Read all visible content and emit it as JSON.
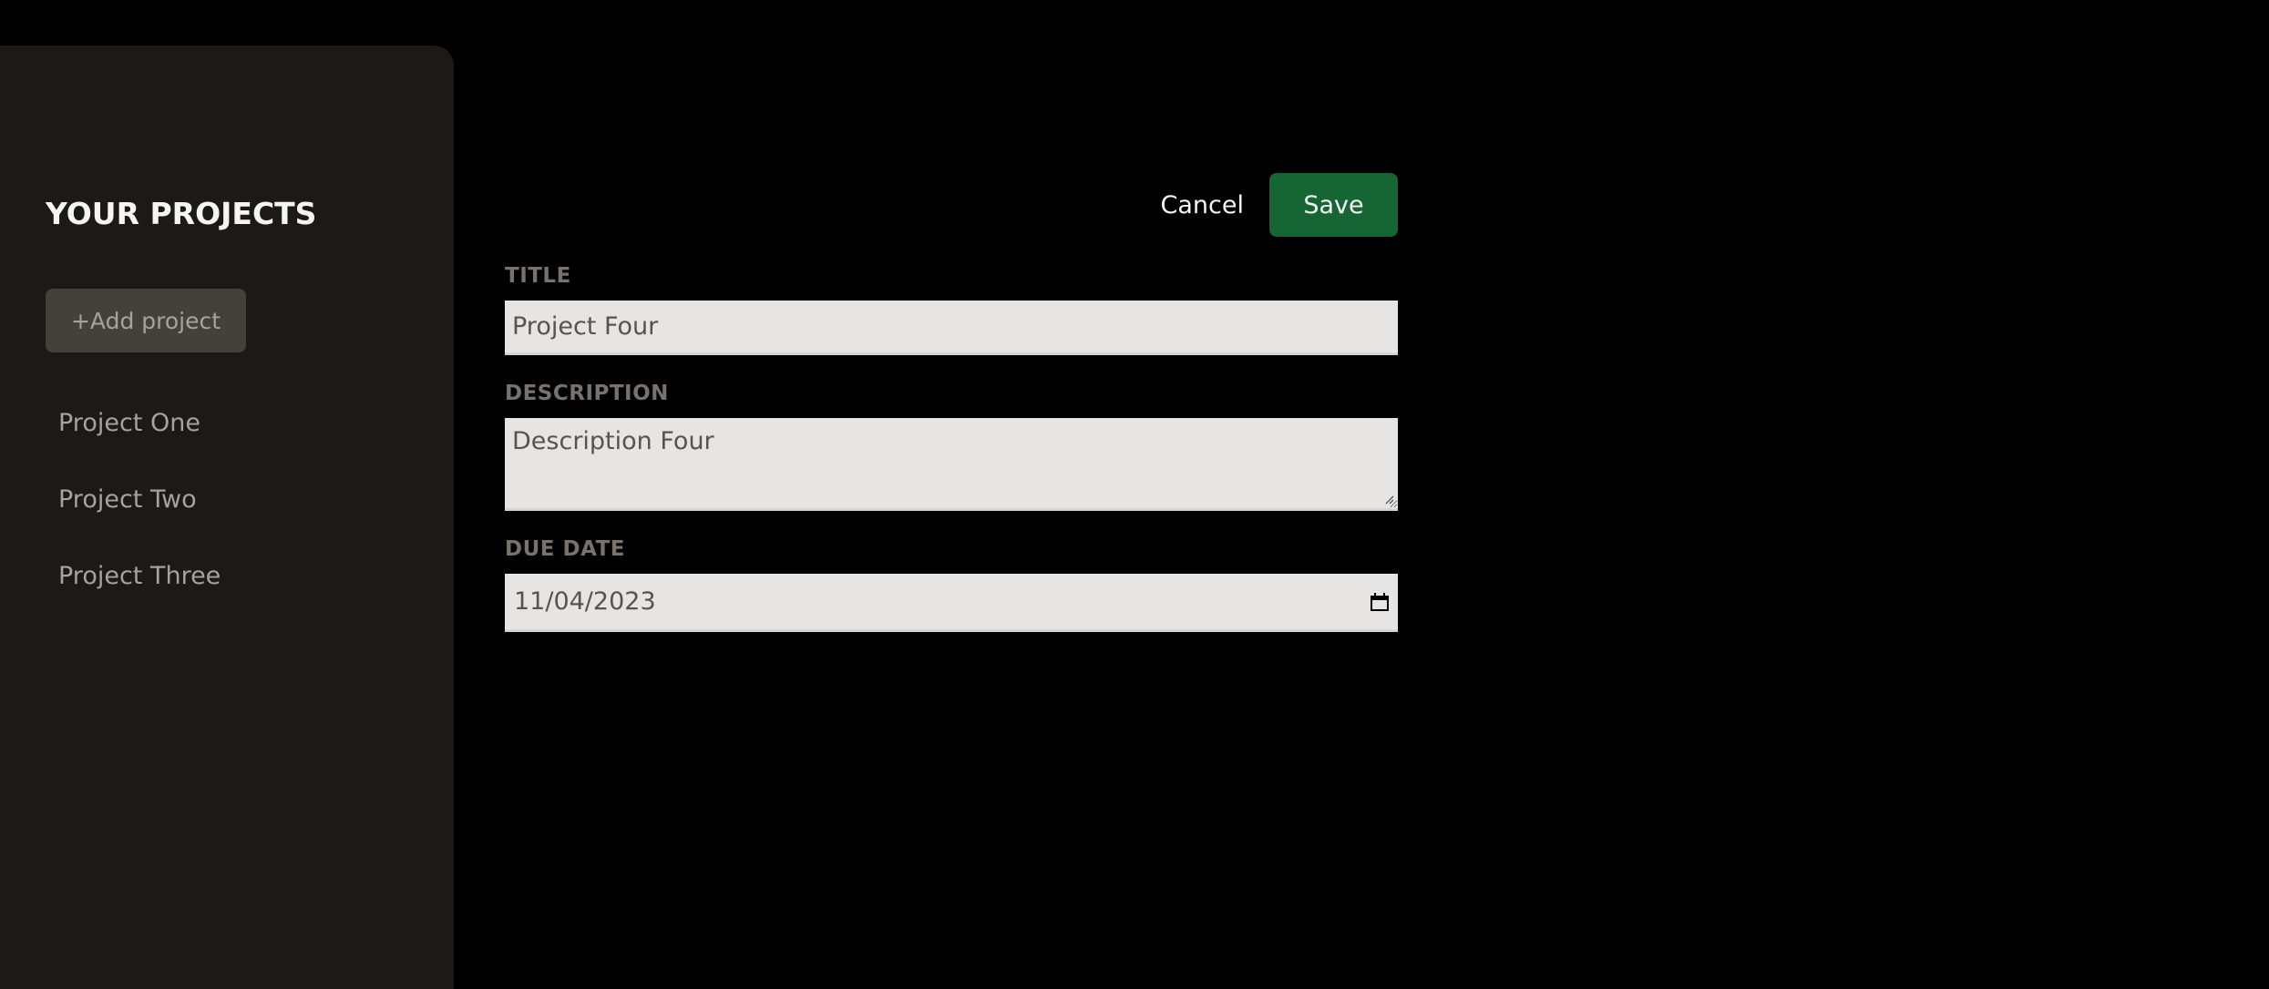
{
  "sidebar": {
    "title": "YOUR PROJECTS",
    "add_button": "+Add project",
    "projects": [
      {
        "label": "Project One"
      },
      {
        "label": "Project Two"
      },
      {
        "label": "Project Three"
      }
    ]
  },
  "form": {
    "cancel_label": "Cancel",
    "save_label": "Save",
    "title_label": "TITLE",
    "title_value": "Project Four",
    "description_label": "DESCRIPTION",
    "description_value": "Description Four",
    "due_date_label": "DUE DATE",
    "due_date_value": "11/04/2023"
  },
  "icons": {
    "date_picker": "calendar-icon",
    "textarea_resize": "resize-grip-icon"
  },
  "colors": {
    "background": "#000000",
    "sidebar": "#1c1917",
    "add_button": "#44403c",
    "save_button": "#166534",
    "input": "#e7e5e4",
    "label": "#78716c"
  }
}
